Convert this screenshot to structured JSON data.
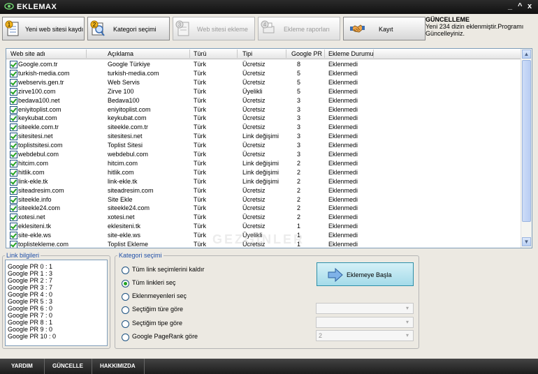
{
  "app": {
    "title": "EKLEMAX",
    "minimize": "_",
    "maximize": "^",
    "close": "x"
  },
  "toolbar": {
    "buttons": [
      {
        "num": "1",
        "label": "Yeni web sitesi kaydı",
        "icon": "notepad-icon"
      },
      {
        "num": "2",
        "label": "Kategori seçimi",
        "icon": "magnifier-icon"
      },
      {
        "num": "3",
        "label": "Web sitesi ekleme",
        "icon": "document-icon"
      },
      {
        "num": "4",
        "label": "Ekleme raporları",
        "icon": "printer-icon"
      },
      {
        "num": "",
        "label": "Kayıt",
        "icon": "handshake-icon"
      }
    ]
  },
  "update": {
    "title": "GÜNCELLEME",
    "text": "Yeni 234 dizin eklenmiştir.Programı Güncelleyiniz."
  },
  "table": {
    "columns": [
      "Web site adı",
      "Açıklama",
      "Türü",
      "Tipi",
      "Google PR",
      "Ekleme Durumu"
    ],
    "rows": [
      [
        "Google.com.tr",
        "Google Türkiye",
        "Türk",
        "Ücretsiz",
        "8",
        "Eklenmedi"
      ],
      [
        "turkish-media.com",
        "turkish-media.com",
        "Türk",
        "Ücretsiz",
        "5",
        "Eklenmedi"
      ],
      [
        "webservis.gen.tr",
        "Web Servis",
        "Türk",
        "Ücretsiz",
        "5",
        "Eklenmedi"
      ],
      [
        "zirve100.com",
        "Zirve 100",
        "Türk",
        "Üyelikli",
        "5",
        "Eklenmedi"
      ],
      [
        "bedava100.net",
        "Bedava100",
        "Türk",
        "Ücretsiz",
        "3",
        "Eklenmedi"
      ],
      [
        "eniyitoplist.com",
        "eniyitoplist.com",
        "Türk",
        "Ücretsiz",
        "3",
        "Eklenmedi"
      ],
      [
        "keykubat.com",
        "keykubat.com",
        "Türk",
        "Ücretsiz",
        "3",
        "Eklenmedi"
      ],
      [
        "siteekle.com.tr",
        "siteekle.com.tr",
        "Türk",
        "Ücretsiz",
        "3",
        "Eklenmedi"
      ],
      [
        "sitesitesi.net",
        "sitesitesi.net",
        "Türk",
        "Link değişimi",
        "3",
        "Eklenmedi"
      ],
      [
        "toplistsitesi.com",
        "Toplist Sitesi",
        "Türk",
        "Ücretsiz",
        "3",
        "Eklenmedi"
      ],
      [
        "webdebul.com",
        "webdebul.com",
        "Türk",
        "Ücretsiz",
        "3",
        "Eklenmedi"
      ],
      [
        "hitcim.com",
        "hitcim.com",
        "Türk",
        "Link değişimi",
        "2",
        "Eklenmedi"
      ],
      [
        "hitlik.com",
        "hitlik.com",
        "Türk",
        "Link değişimi",
        "2",
        "Eklenmedi"
      ],
      [
        "link-ekle.tk",
        "link-ekle.tk",
        "Türk",
        "Link değişimi",
        "2",
        "Eklenmedi"
      ],
      [
        "siteadresim.com",
        "siteadresim.com",
        "Türk",
        "Ücretsiz",
        "2",
        "Eklenmedi"
      ],
      [
        "siteekle.info",
        "Site Ekle",
        "Türk",
        "Ücretsiz",
        "2",
        "Eklenmedi"
      ],
      [
        "siteekle24.com",
        "siteekle24.com",
        "Türk",
        "Ücretsiz",
        "2",
        "Eklenmedi"
      ],
      [
        "xotesi.net",
        "xotesi.net",
        "Türk",
        "Ücretsiz",
        "2",
        "Eklenmedi"
      ],
      [
        "eklesiteni.tk",
        "eklesiteni.tk",
        "Türk",
        "Ücretsiz",
        "1",
        "Eklenmedi"
      ],
      [
        "site-ekle.ws",
        "site-ekle.ws",
        "Türk",
        "Üyelikli",
        "1",
        "Eklenmedi"
      ],
      [
        "toplistekleme.com",
        "Toplist Ekleme",
        "Türk",
        "Ücretsiz",
        "1",
        "Eklenmedi"
      ]
    ]
  },
  "link_info": {
    "title": "Link bilgileri",
    "lines": [
      "Google PR 0 : 1",
      "Google PR 1 : 3",
      "Google PR 2 : 7",
      "Google PR 3 : 7",
      "Google PR 4 : 0",
      "Google PR 5 : 3",
      "Google PR 6 : 0",
      "Google PR 7 : 0",
      "Google PR 8 : 1",
      "Google PR 9 : 0",
      "Google PR 10 : 0"
    ]
  },
  "category": {
    "title": "Kategori seçimi",
    "options": [
      "Tüm link seçimlerini kaldır",
      "Tüm linkleri seç",
      "Eklenmeyenleri seç",
      "Seçtiğim türe göre",
      "Seçtiğim tipe göre",
      "Google PageRank göre"
    ],
    "selected_index": 1,
    "pr_select_value": "2"
  },
  "start_button": {
    "label": "Eklemeye Başla"
  },
  "bottom": {
    "items": [
      "YARDIM",
      "GÜNCELLE",
      "HAKKIMIZDA"
    ]
  },
  "watermark": "GEZGINLER"
}
